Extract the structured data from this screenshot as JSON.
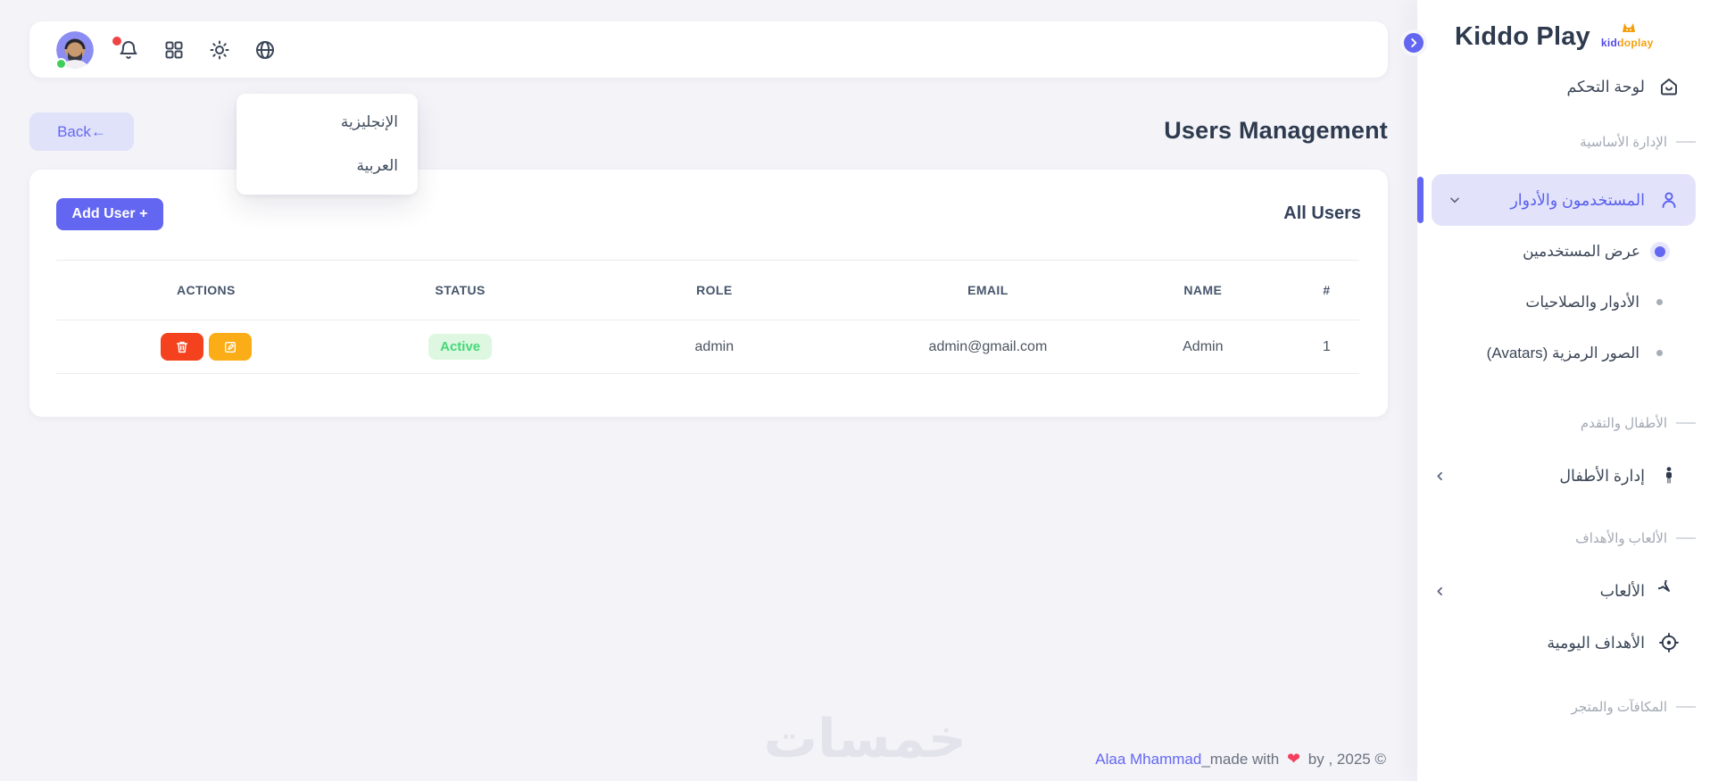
{
  "page": {
    "title": "Users Management",
    "back_button": "Back←"
  },
  "header": {
    "icons": {
      "avatar": "user-photo",
      "bell": "notifications",
      "grid": "apps",
      "sun": "theme-light",
      "globe": "language"
    }
  },
  "language_menu": {
    "items": [
      {
        "label": "الإنجليزية"
      },
      {
        "label": "العربية"
      }
    ]
  },
  "users_section": {
    "heading": "All Users",
    "add_user_button": "Add User +",
    "table": {
      "headers": {
        "index": "#",
        "name": "NAME",
        "email": "EMAIL",
        "role": "ROLE",
        "status": "STATUS",
        "actions": "ACTIONS"
      },
      "rows": [
        {
          "index": "1",
          "name": "Admin",
          "email": "admin@gmail.com",
          "role": "admin",
          "status": "Active"
        }
      ]
    }
  },
  "sidebar": {
    "brand": "Kiddo Play",
    "logo_text": "kiddoplay",
    "items": [
      {
        "label": "لوحة التحكم",
        "icon": "home-icon",
        "type": "item"
      },
      {
        "label": "الإدارة الأساسية",
        "type": "section"
      },
      {
        "label": "المستخدمون والأدوار",
        "icon": "users-icon",
        "type": "item",
        "state": "active-expanded"
      },
      {
        "label": "عرض المستخدمين",
        "type": "sub-item",
        "state": "active"
      },
      {
        "label": "الأدوار والصلاحيات",
        "type": "sub-item"
      },
      {
        "label": "الصور الرمزية (Avatars)",
        "type": "sub-item"
      },
      {
        "label": "الأطفال والتقدم",
        "type": "section"
      },
      {
        "label": "إدارة الأطفال",
        "icon": "child-icon",
        "type": "item",
        "collapsible": true
      },
      {
        "label": "الألعاب والأهداف",
        "type": "section"
      },
      {
        "label": "الألعاب",
        "icon": "games-icon",
        "type": "item",
        "collapsible": true
      },
      {
        "label": "الأهداف اليومية",
        "icon": "target-icon",
        "type": "item"
      },
      {
        "label": "المكافآت والمتجر",
        "type": "section"
      }
    ]
  },
  "footer": {
    "author_link": "Alaa Mhammad",
    "made_with": "_made with ",
    "heart_icon": "❤",
    "suffix": " by , 2025 ©"
  },
  "watermark": "خمسات",
  "colors": {
    "accent": "#6366f1",
    "accent_light_bg": "#e2e3fb",
    "danger": "#f5421e",
    "warning": "#fbad18",
    "success_bg": "#ddf7e1",
    "success_text": "#45d878",
    "heart": "#f43f5e",
    "page_bg": "#f3f3f8"
  }
}
